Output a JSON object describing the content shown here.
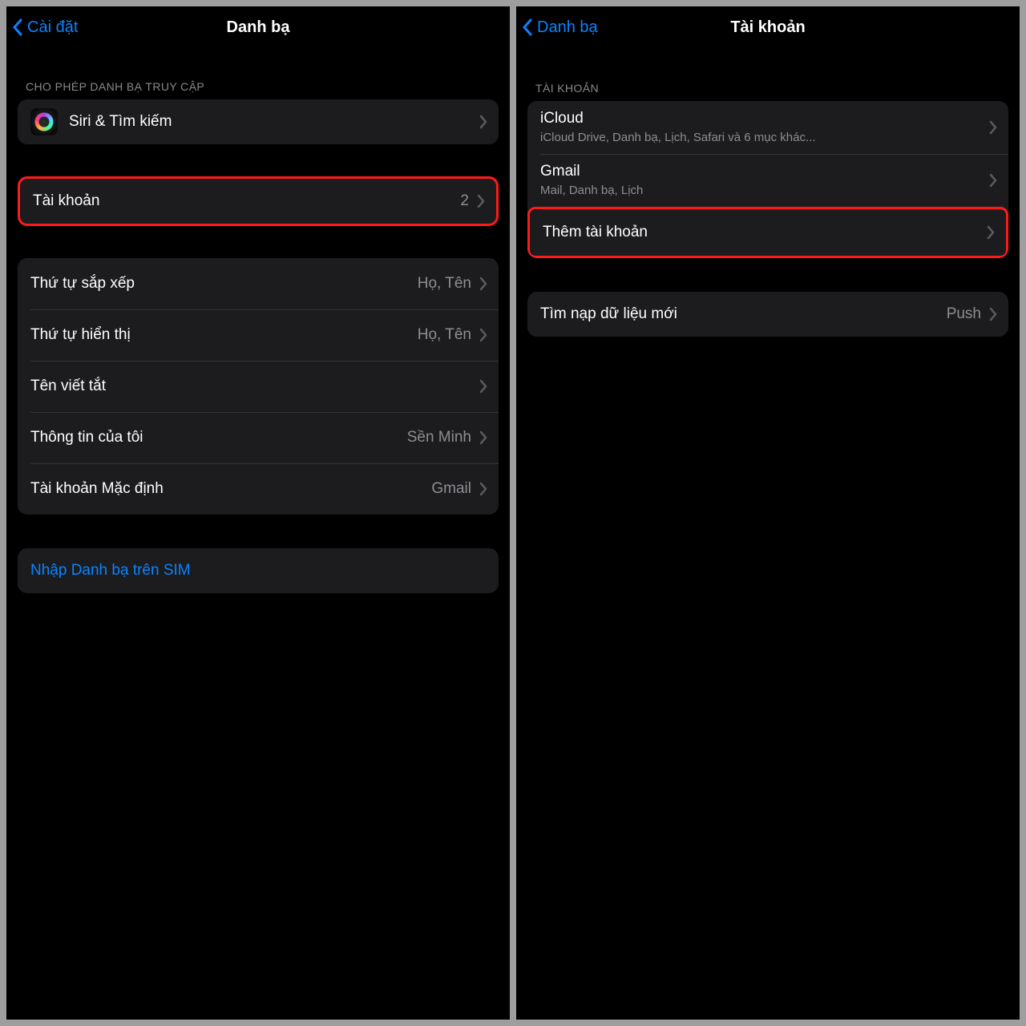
{
  "left": {
    "nav": {
      "back": "Cài đặt",
      "title": "Danh bạ"
    },
    "section1_header": "CHO PHÉP DANH BẠ TRUY CẬP",
    "siri_label": "Siri & Tìm kiếm",
    "accounts_label": "Tài khoản",
    "accounts_count": "2",
    "settings": {
      "sort_label": "Thứ tự sắp xếp",
      "sort_value": "Họ, Tên",
      "display_label": "Thứ tự hiển thị",
      "display_value": "Họ, Tên",
      "shortname_label": "Tên viết tắt",
      "myinfo_label": "Thông tin của tôi",
      "myinfo_value": "Sền Minh",
      "default_label": "Tài khoản Mặc định",
      "default_value": "Gmail"
    },
    "import_sim": "Nhập Danh bạ trên SIM"
  },
  "right": {
    "nav": {
      "back": "Danh bạ",
      "title": "Tài khoản"
    },
    "section1_header": "TÀI KHOẢN",
    "accounts": [
      {
        "title": "iCloud",
        "sub": "iCloud Drive, Danh bạ, Lịch, Safari và 6 mục khác..."
      },
      {
        "title": "Gmail",
        "sub": "Mail, Danh bạ, Lịch"
      }
    ],
    "add_account": "Thêm tài khoản",
    "fetch_label": "Tìm nạp dữ liệu mới",
    "fetch_value": "Push"
  }
}
